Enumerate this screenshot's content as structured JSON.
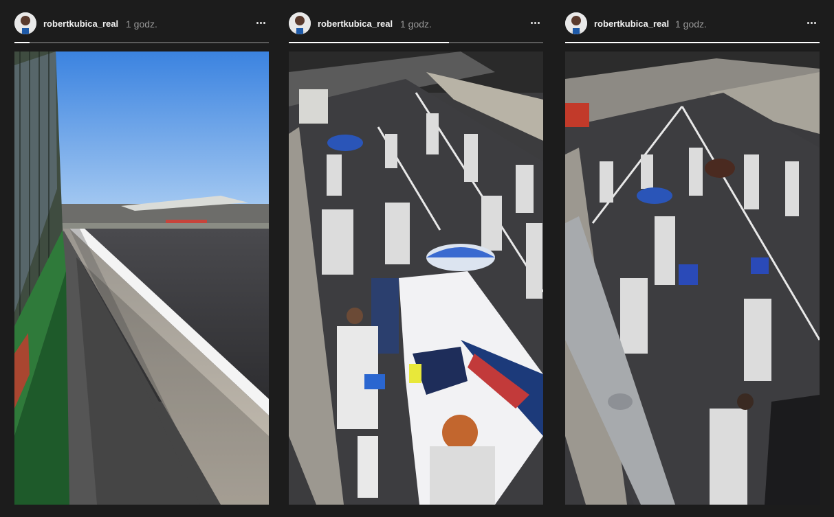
{
  "stories": [
    {
      "username": "robertkubica_real",
      "time": "1 godz.",
      "progress": 0.06,
      "media": "track-pit-wall-video"
    },
    {
      "username": "robertkubica_real",
      "time": "1 godz.",
      "progress": 0.63,
      "media": "grid-williams-car-video"
    },
    {
      "username": "robertkubica_real",
      "time": "1 godz.",
      "progress": 1.0,
      "media": "grid-mechanics-video"
    }
  ],
  "icons": {
    "more": "more-options-icon",
    "avatar": "profile-avatar"
  }
}
